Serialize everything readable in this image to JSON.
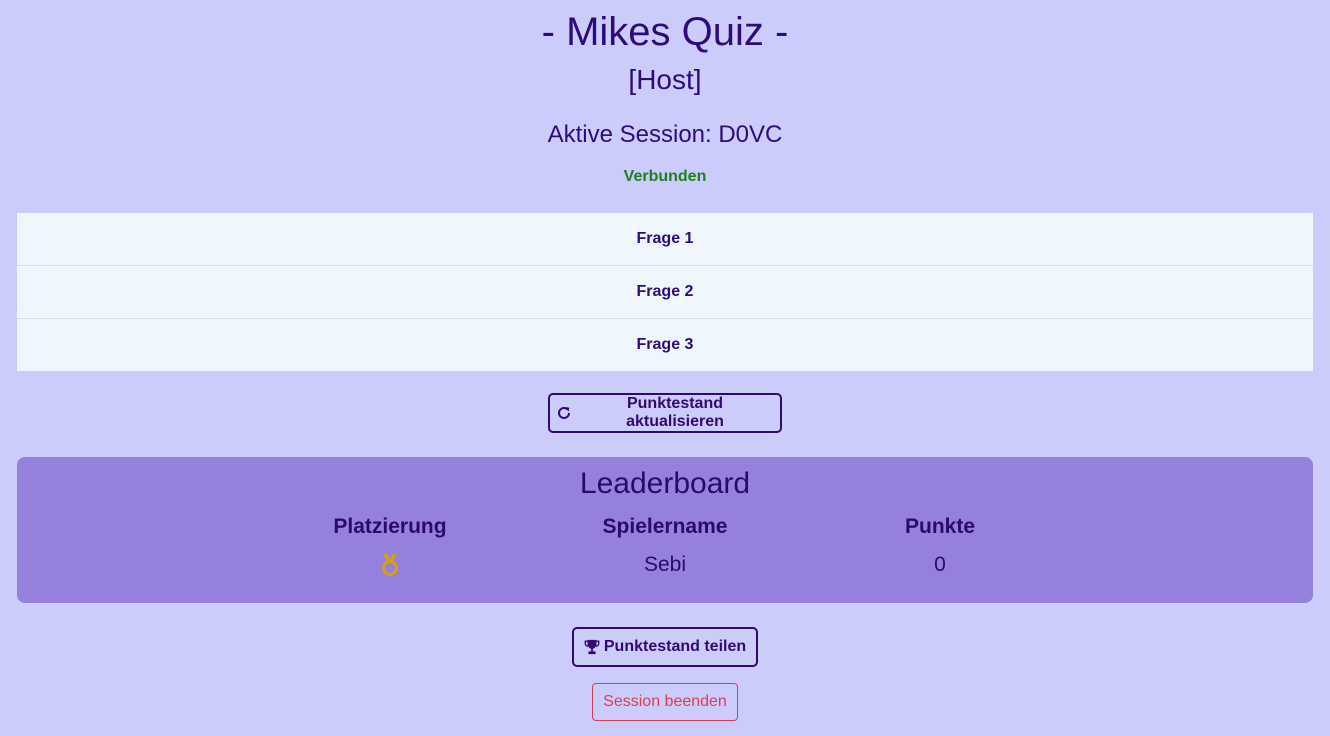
{
  "header": {
    "title": "- Mikes Quiz -",
    "role": "[Host]",
    "session": "Aktive Session: D0VC",
    "status": "Verbunden"
  },
  "questions": [
    {
      "label": "Frage 1"
    },
    {
      "label": "Frage 2"
    },
    {
      "label": "Frage 3"
    }
  ],
  "actions": {
    "refresh_label": "Punktestand aktualisieren",
    "share_label": "Punktestand teilen",
    "end_label": "Session beenden"
  },
  "leaderboard": {
    "title": "Leaderboard",
    "columns": [
      "Platzierung",
      "Spielername",
      "Punkte"
    ],
    "rows": [
      {
        "place_icon": "gold-medal-icon",
        "player": "Sebi",
        "points": "0"
      }
    ]
  },
  "colors": {
    "background": "#ccccfc",
    "text": "#34086e",
    "status_connected": "#1d7f1d",
    "leaderboard_bg": "#9580dc",
    "danger": "#d9404e",
    "medal": "#d4a017"
  }
}
